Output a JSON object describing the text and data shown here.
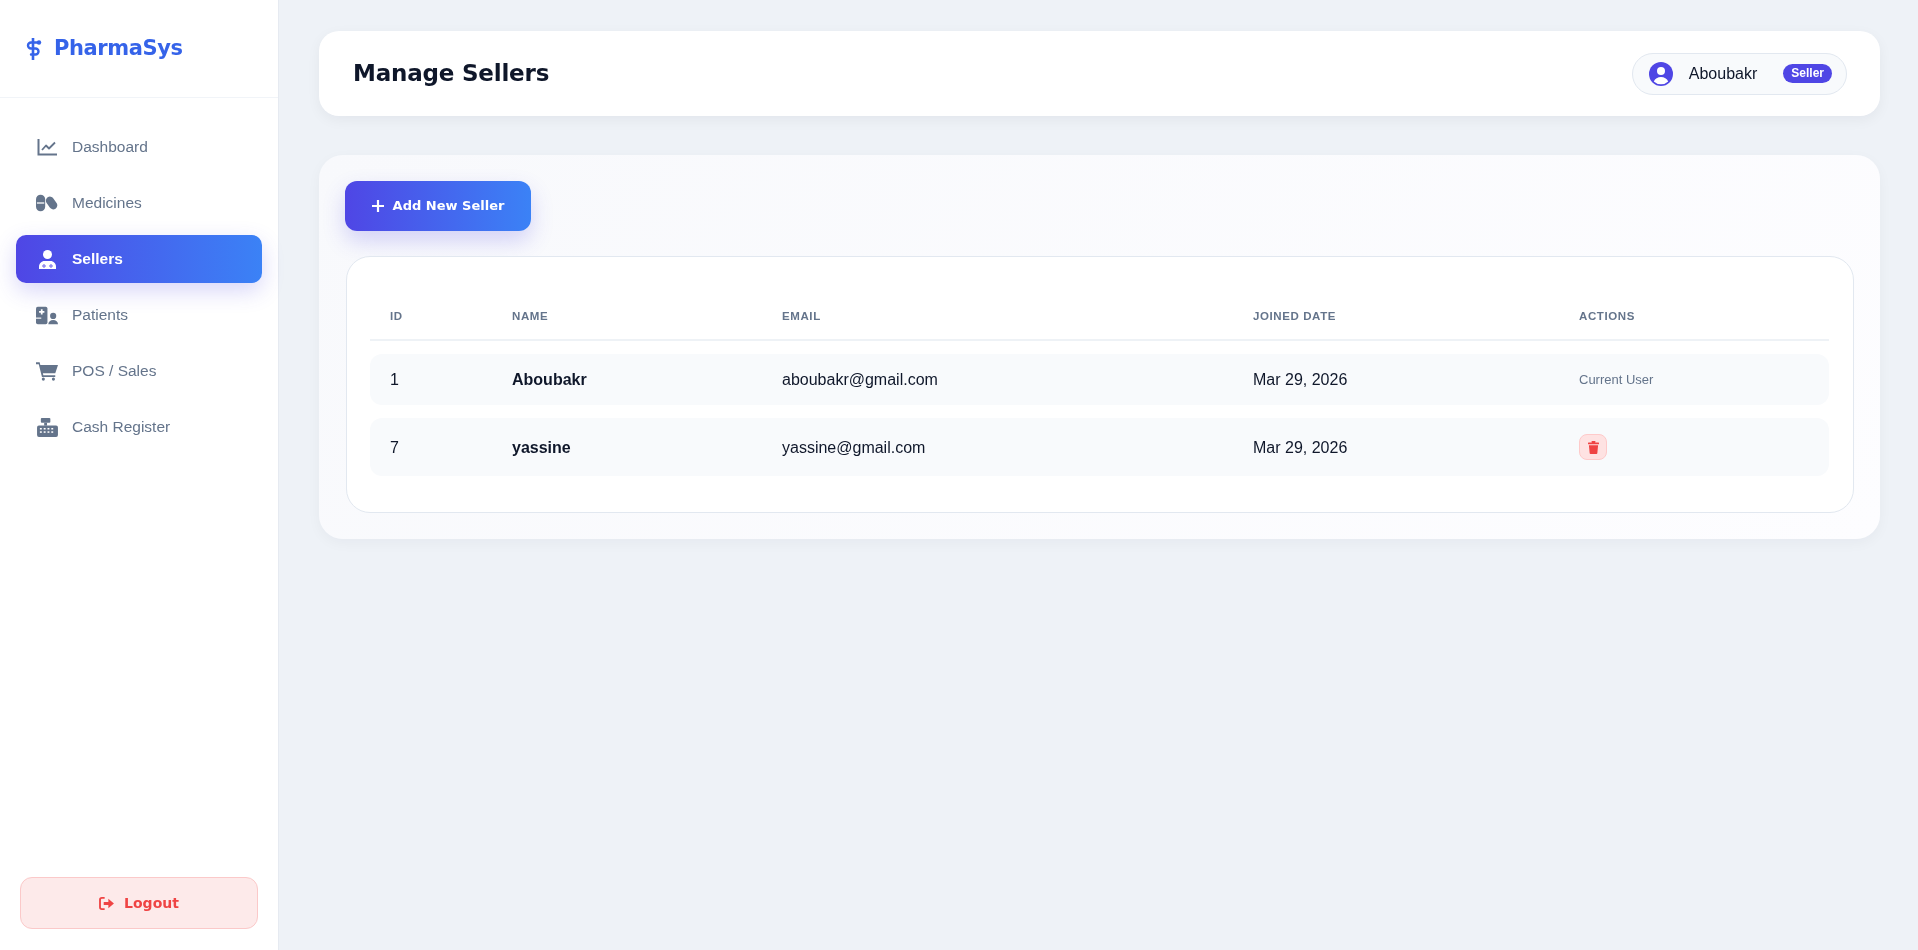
{
  "sidebar": {
    "brand": "PharmaSys",
    "items": [
      {
        "label": "Dashboard",
        "selected": false
      },
      {
        "label": "Medicines",
        "selected": false
      },
      {
        "label": "Sellers",
        "selected": true
      },
      {
        "label": "Patients",
        "selected": false
      },
      {
        "label": "POS / Sales",
        "selected": false
      },
      {
        "label": "Cash Register",
        "selected": false
      }
    ],
    "logout": "Logout"
  },
  "header": {
    "title": "Manage Sellers",
    "user": {
      "name": "Aboubakr",
      "role": "Seller"
    }
  },
  "toolbar": {
    "add_button": "Add New Seller"
  },
  "table": {
    "columns": [
      "ID",
      "NAME",
      "EMAIL",
      "JOINED DATE",
      "ACTIONS"
    ],
    "rows": [
      {
        "id": "1",
        "name": "Aboubakr",
        "email": "aboubakr@gmail.com",
        "joined_date": "Mar 29, 2026",
        "action": {
          "kind": "text",
          "text": "Current User"
        }
      },
      {
        "id": "7",
        "name": "yassine",
        "email": "yassine@gmail.com",
        "joined_date": "Mar 29, 2026",
        "action": {
          "kind": "delete"
        }
      }
    ]
  }
}
